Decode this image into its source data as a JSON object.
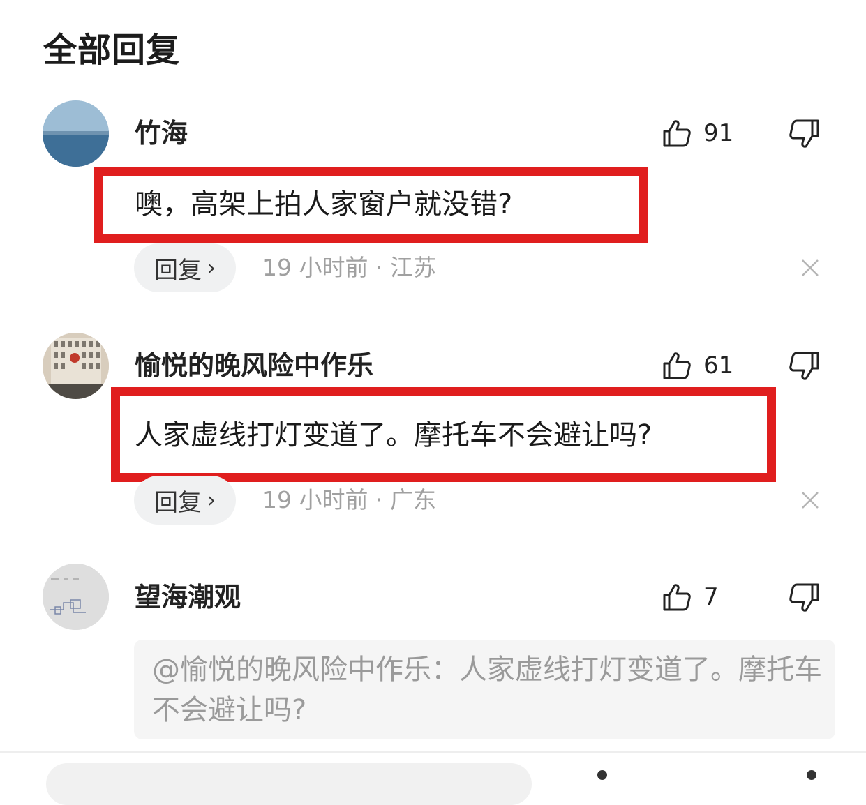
{
  "header": {
    "title": "全部回复"
  },
  "comments": [
    {
      "username": "竹海",
      "text": "噢，高架上拍人家窗户就没错?",
      "likes": "91",
      "reply_label": "回复",
      "meta": "19 小时前 · 江苏"
    },
    {
      "username": "愉悦的晚风险中作乐",
      "text": "人家虚线打灯变道了。摩托车不会避让吗?",
      "likes": "61",
      "reply_label": "回复",
      "meta": "19 小时前 · 广东"
    },
    {
      "username": "望海潮观",
      "quote": "@愉悦的晚风险中作乐：人家虚线打灯变道了。摩托车不会避让吗?",
      "likes": "7"
    }
  ],
  "icons": {
    "like": "thumbs-up-icon",
    "dislike": "thumbs-down-icon",
    "close": "close-icon",
    "reply_chevron": "chevron-right-icon"
  },
  "colors": {
    "highlight": "#e01e1e",
    "meta_text": "#a0a0a0",
    "reply_bg": "#f0f1f2"
  }
}
